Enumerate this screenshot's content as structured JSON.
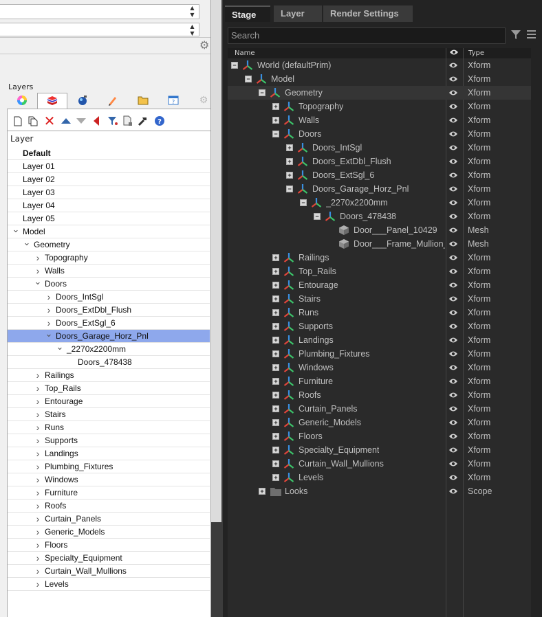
{
  "left_panel": {
    "layers_title": "Layers",
    "list_header": "Layer",
    "rows": [
      {
        "label": "Default",
        "indent": 0,
        "chevron": "",
        "bold": true
      },
      {
        "label": "Layer 01",
        "indent": 0,
        "chevron": ""
      },
      {
        "label": "Layer 02",
        "indent": 0,
        "chevron": ""
      },
      {
        "label": "Layer 03",
        "indent": 0,
        "chevron": ""
      },
      {
        "label": "Layer 04",
        "indent": 0,
        "chevron": ""
      },
      {
        "label": "Layer 05",
        "indent": 0,
        "chevron": ""
      },
      {
        "label": "Model",
        "indent": 0,
        "chevron": "down"
      },
      {
        "label": "Geometry",
        "indent": 1,
        "chevron": "down"
      },
      {
        "label": "Topography",
        "indent": 2,
        "chevron": "right"
      },
      {
        "label": "Walls",
        "indent": 2,
        "chevron": "right"
      },
      {
        "label": "Doors",
        "indent": 2,
        "chevron": "down"
      },
      {
        "label": "Doors_IntSgl",
        "indent": 3,
        "chevron": "right"
      },
      {
        "label": "Doors_ExtDbl_Flush",
        "indent": 3,
        "chevron": "right"
      },
      {
        "label": "Doors_ExtSgl_6",
        "indent": 3,
        "chevron": "right"
      },
      {
        "label": "Doors_Garage_Horz_Pnl",
        "indent": 3,
        "chevron": "down",
        "selected": true
      },
      {
        "label": "_2270x2200mm",
        "indent": 4,
        "chevron": "down"
      },
      {
        "label": "Doors_478438",
        "indent": 5,
        "chevron": ""
      },
      {
        "label": "Railings",
        "indent": 2,
        "chevron": "right"
      },
      {
        "label": "Top_Rails",
        "indent": 2,
        "chevron": "right"
      },
      {
        "label": "Entourage",
        "indent": 2,
        "chevron": "right"
      },
      {
        "label": "Stairs",
        "indent": 2,
        "chevron": "right"
      },
      {
        "label": "Runs",
        "indent": 2,
        "chevron": "right"
      },
      {
        "label": "Supports",
        "indent": 2,
        "chevron": "right"
      },
      {
        "label": "Landings",
        "indent": 2,
        "chevron": "right"
      },
      {
        "label": "Plumbing_Fixtures",
        "indent": 2,
        "chevron": "right"
      },
      {
        "label": "Windows",
        "indent": 2,
        "chevron": "right"
      },
      {
        "label": "Furniture",
        "indent": 2,
        "chevron": "right"
      },
      {
        "label": "Roofs",
        "indent": 2,
        "chevron": "right"
      },
      {
        "label": "Curtain_Panels",
        "indent": 2,
        "chevron": "right"
      },
      {
        "label": "Generic_Models",
        "indent": 2,
        "chevron": "right"
      },
      {
        "label": "Floors",
        "indent": 2,
        "chevron": "right"
      },
      {
        "label": "Specialty_Equipment",
        "indent": 2,
        "chevron": "right"
      },
      {
        "label": "Curtain_Wall_Mullions",
        "indent": 2,
        "chevron": "right"
      },
      {
        "label": "Levels",
        "indent": 2,
        "chevron": "right"
      }
    ],
    "tab_icons": [
      "color-wheel-icon",
      "layers-icon",
      "sphere-icon",
      "pencil-icon",
      "folder-icon",
      "help-panel-icon",
      "gear-icon"
    ],
    "toolbar_icons": [
      "new-layer-icon",
      "new-sublayer-icon",
      "delete-icon",
      "move-up-icon",
      "move-down-icon",
      "arrow-left-icon",
      "filter-icon",
      "copy-icon",
      "tools-icon",
      "help-icon"
    ]
  },
  "stage_panel": {
    "tabs": [
      "Stage",
      "Layer",
      "Render Settings"
    ],
    "active_tab": "Stage",
    "search_placeholder": "Search",
    "columns": {
      "name": "Name",
      "type": "Type"
    },
    "rows": [
      {
        "name": "World (defaultPrim)",
        "depth": 0,
        "expander": "minus",
        "icon": "xform",
        "type": "Xform"
      },
      {
        "name": "Model",
        "depth": 1,
        "expander": "minus",
        "icon": "xform",
        "type": "Xform"
      },
      {
        "name": "Geometry",
        "depth": 2,
        "expander": "minus",
        "icon": "xform",
        "type": "Xform",
        "highlight": true
      },
      {
        "name": "Topography",
        "depth": 3,
        "expander": "plus",
        "icon": "xform",
        "type": "Xform"
      },
      {
        "name": "Walls",
        "depth": 3,
        "expander": "plus",
        "icon": "xform",
        "type": "Xform"
      },
      {
        "name": "Doors",
        "depth": 3,
        "expander": "minus",
        "icon": "xform",
        "type": "Xform"
      },
      {
        "name": "Doors_IntSgl",
        "depth": 4,
        "expander": "plus",
        "icon": "xform",
        "type": "Xform"
      },
      {
        "name": "Doors_ExtDbl_Flush",
        "depth": 4,
        "expander": "plus",
        "icon": "xform",
        "type": "Xform"
      },
      {
        "name": "Doors_ExtSgl_6",
        "depth": 4,
        "expander": "plus",
        "icon": "xform",
        "type": "Xform"
      },
      {
        "name": "Doors_Garage_Horz_Pnl",
        "depth": 4,
        "expander": "minus",
        "icon": "xform",
        "type": "Xform"
      },
      {
        "name": "_2270x2200mm",
        "depth": 5,
        "expander": "minus",
        "icon": "xform",
        "type": "Xform"
      },
      {
        "name": "Doors_478438",
        "depth": 6,
        "expander": "minus",
        "icon": "xform",
        "type": "Xform"
      },
      {
        "name": "Door___Panel_10429",
        "depth": 7,
        "expander": "",
        "icon": "mesh",
        "type": "Mesh"
      },
      {
        "name": "Door___Frame_Mullion_",
        "depth": 7,
        "expander": "",
        "icon": "mesh",
        "type": "Mesh"
      },
      {
        "name": "Railings",
        "depth": 3,
        "expander": "plus",
        "icon": "xform",
        "type": "Xform"
      },
      {
        "name": "Top_Rails",
        "depth": 3,
        "expander": "plus",
        "icon": "xform",
        "type": "Xform"
      },
      {
        "name": "Entourage",
        "depth": 3,
        "expander": "plus",
        "icon": "xform",
        "type": "Xform"
      },
      {
        "name": "Stairs",
        "depth": 3,
        "expander": "plus",
        "icon": "xform",
        "type": "Xform"
      },
      {
        "name": "Runs",
        "depth": 3,
        "expander": "plus",
        "icon": "xform",
        "type": "Xform"
      },
      {
        "name": "Supports",
        "depth": 3,
        "expander": "plus",
        "icon": "xform",
        "type": "Xform"
      },
      {
        "name": "Landings",
        "depth": 3,
        "expander": "plus",
        "icon": "xform",
        "type": "Xform"
      },
      {
        "name": "Plumbing_Fixtures",
        "depth": 3,
        "expander": "plus",
        "icon": "xform",
        "type": "Xform"
      },
      {
        "name": "Windows",
        "depth": 3,
        "expander": "plus",
        "icon": "xform",
        "type": "Xform"
      },
      {
        "name": "Furniture",
        "depth": 3,
        "expander": "plus",
        "icon": "xform",
        "type": "Xform"
      },
      {
        "name": "Roofs",
        "depth": 3,
        "expander": "plus",
        "icon": "xform",
        "type": "Xform"
      },
      {
        "name": "Curtain_Panels",
        "depth": 3,
        "expander": "plus",
        "icon": "xform",
        "type": "Xform"
      },
      {
        "name": "Generic_Models",
        "depth": 3,
        "expander": "plus",
        "icon": "xform",
        "type": "Xform"
      },
      {
        "name": "Floors",
        "depth": 3,
        "expander": "plus",
        "icon": "xform",
        "type": "Xform"
      },
      {
        "name": "Specialty_Equipment",
        "depth": 3,
        "expander": "plus",
        "icon": "xform",
        "type": "Xform"
      },
      {
        "name": "Curtain_Wall_Mullions",
        "depth": 3,
        "expander": "plus",
        "icon": "xform",
        "type": "Xform"
      },
      {
        "name": "Levels",
        "depth": 3,
        "expander": "plus",
        "icon": "xform",
        "type": "Xform"
      },
      {
        "name": "Looks",
        "depth": 2,
        "expander": "plus",
        "icon": "folder",
        "type": "Scope"
      }
    ]
  },
  "colors": {
    "selection": "#8ea8ec",
    "axis_red": "#e0453a",
    "axis_green": "#3cc46a",
    "axis_blue": "#3a8fe0"
  }
}
